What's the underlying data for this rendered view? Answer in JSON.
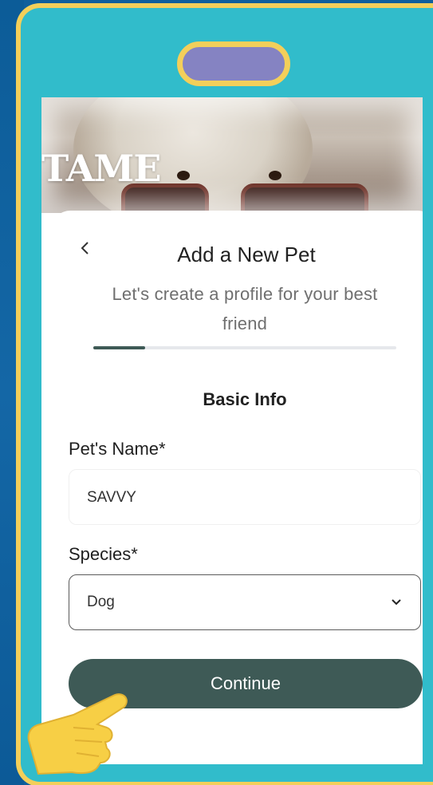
{
  "app": {
    "brand": "TAME"
  },
  "header": {
    "back_icon": "chevron-left-icon",
    "title": "Add a New Pet",
    "subtitle": "Let's create a profile for your best friend"
  },
  "progress": {
    "fraction": 0.17
  },
  "form": {
    "section_title": "Basic Info",
    "name_label": "Pet's Name*",
    "name_value": "SAVVY",
    "species_label": "Species*",
    "species_value": "Dog",
    "continue_label": "Continue"
  },
  "colors": {
    "frame": "#31bccb",
    "bezel": "#f3cf5a",
    "accent": "#3e5a56",
    "background": "#0f5f9c"
  }
}
